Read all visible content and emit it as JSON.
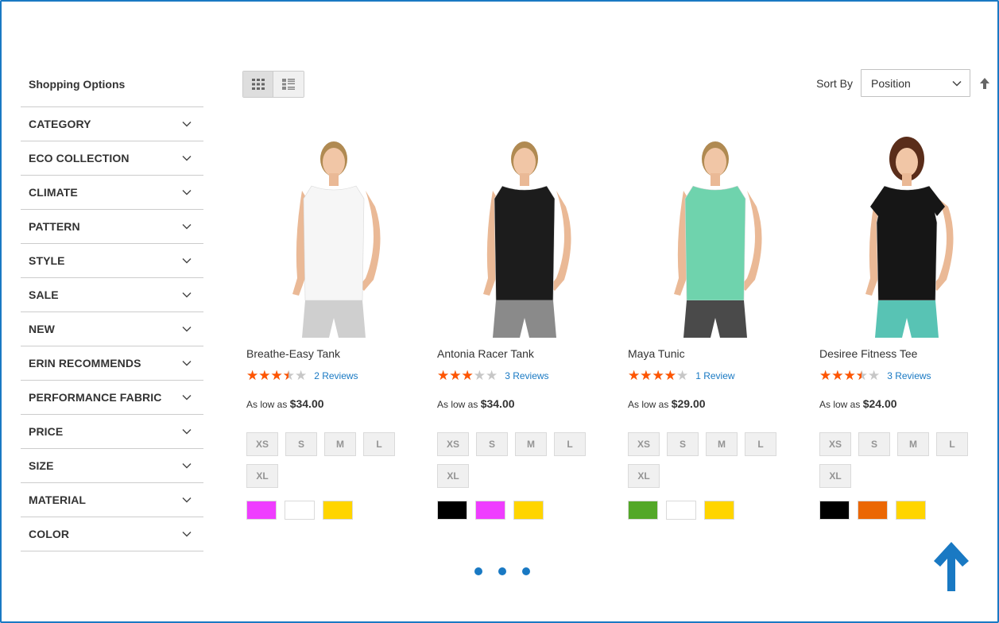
{
  "sidebar": {
    "title": "Shopping Options",
    "filters": [
      {
        "label": "CATEGORY"
      },
      {
        "label": "ECO COLLECTION"
      },
      {
        "label": "CLIMATE"
      },
      {
        "label": "PATTERN"
      },
      {
        "label": "STYLE"
      },
      {
        "label": "SALE"
      },
      {
        "label": "NEW"
      },
      {
        "label": "ERIN RECOMMENDS"
      },
      {
        "label": "PERFORMANCE FABRIC"
      },
      {
        "label": "PRICE"
      },
      {
        "label": "SIZE"
      },
      {
        "label": "MATERIAL"
      },
      {
        "label": "COLOR"
      }
    ]
  },
  "toolbar": {
    "view_modes": [
      {
        "icon": "grid-icon",
        "active": true
      },
      {
        "icon": "list-icon",
        "active": false
      }
    ],
    "sort_label": "Sort By",
    "sort_value": "Position",
    "sort_direction_icon": "arrow-up-icon"
  },
  "products": [
    {
      "name": "Breathe-Easy Tank",
      "rating": 3.5,
      "reviews": "2 Reviews",
      "price_prefix": "As low as",
      "price": "$34.00",
      "sizes": [
        "XS",
        "S",
        "M",
        "L",
        "XL"
      ],
      "colors": [
        "#ef3dff",
        "#ffffff",
        "#ffd500"
      ],
      "shirt_color": "#f6f6f6",
      "bottom_color": "#cfcfcf"
    },
    {
      "name": "Antonia Racer Tank",
      "rating": 3,
      "reviews": "3 Reviews",
      "price_prefix": "As low as",
      "price": "$34.00",
      "sizes": [
        "XS",
        "S",
        "M",
        "L",
        "XL"
      ],
      "colors": [
        "#000000",
        "#ef3dff",
        "#ffd500"
      ],
      "shirt_color": "#1c1c1c",
      "bottom_color": "#8a8a8a"
    },
    {
      "name": "Maya Tunic",
      "rating": 4,
      "reviews": "1 Review",
      "price_prefix": "As low as",
      "price": "$29.00",
      "sizes": [
        "XS",
        "S",
        "M",
        "L",
        "XL"
      ],
      "colors": [
        "#53a828",
        "#ffffff",
        "#ffd500"
      ],
      "shirt_color": "#6fd3ad",
      "bottom_color": "#4a4a4a"
    },
    {
      "name": "Desiree Fitness Tee",
      "rating": 3.5,
      "reviews": "3 Reviews",
      "price_prefix": "As low as",
      "price": "$24.00",
      "sizes": [
        "XS",
        "S",
        "M",
        "L",
        "XL"
      ],
      "colors": [
        "#000000",
        "#eb6703",
        "#ffd500"
      ],
      "shirt_color": "#161616",
      "bottom_color": "#58c3b4"
    }
  ],
  "pagination": {
    "dot_count": 3
  },
  "colors": {
    "accent": "#1979c3",
    "star": "#ff5501"
  }
}
